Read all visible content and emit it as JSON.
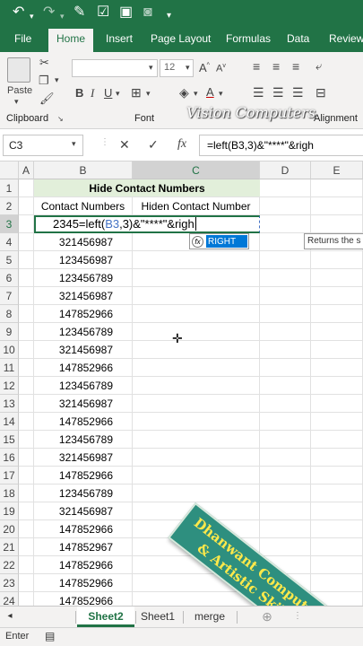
{
  "tabs": [
    "File",
    "Home",
    "Insert",
    "Page Layout",
    "Formulas",
    "Data",
    "Review"
  ],
  "active_tab": "Home",
  "ribbon": {
    "paste_label": "Paste",
    "font_size": "12",
    "groups": {
      "clipboard": "Clipboard",
      "font": "Font",
      "alignment": "Alignment"
    }
  },
  "watermark": "Vision Computers",
  "formula_bar": {
    "name_box": "C3",
    "fx_label": "fx",
    "formula": "=left(B3,3)&\"****\"&righ"
  },
  "columns": [
    "A",
    "B",
    "C",
    "D",
    "E"
  ],
  "rows": [
    "1",
    "2",
    "3",
    "4",
    "5",
    "6",
    "7",
    "8",
    "9",
    "10",
    "11",
    "12",
    "13",
    "14",
    "15",
    "16",
    "17",
    "18",
    "19",
    "20",
    "21",
    "22",
    "23",
    "24"
  ],
  "title": "Hide Contact Numbers",
  "headers": {
    "b": "Contact Numbers",
    "c": "Hiden Contact Number"
  },
  "editing": {
    "b_tail": "2345",
    "pre": "=left(",
    "ref": "B3",
    "post": ",3)&\"****\"&righ"
  },
  "numbers": [
    "321456987",
    "123456987",
    "123456789",
    "321456987",
    "147852966",
    "123456789",
    "321456987",
    "147852966",
    "123456789",
    "321456987",
    "147852966",
    "123456789",
    "321456987",
    "147852966",
    "123456789",
    "321456987",
    "147852966",
    "147852967",
    "147852966",
    "147852966",
    "147852966"
  ],
  "autocomplete": {
    "name": "RIGHT",
    "tooltip": "Returns the s"
  },
  "banner": {
    "line1": "Dhanwant Computer",
    "line2": "& Artistic Skills"
  },
  "sheets": [
    "Sheet2",
    "Sheet1",
    "merge"
  ],
  "active_sheet": "Sheet2",
  "status": "Enter",
  "colors": {
    "brand": "#217346",
    "title_fill": "#e2efda",
    "banner": "#2e8f7f",
    "banner_text": "#ffe94a",
    "select": "#0078d7"
  }
}
